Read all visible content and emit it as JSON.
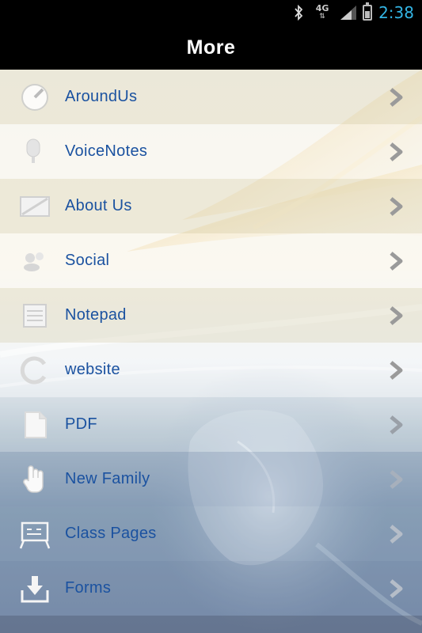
{
  "status_bar": {
    "network": "4G",
    "time": "2:38"
  },
  "header": {
    "title": "More"
  },
  "menu": {
    "items": [
      {
        "label": "AroundUs",
        "icon": "compass-icon"
      },
      {
        "label": "VoiceNotes",
        "icon": "microphone-icon"
      },
      {
        "label": "About Us",
        "icon": "info-icon"
      },
      {
        "label": "Social",
        "icon": "people-icon"
      },
      {
        "label": "Notepad",
        "icon": "notepad-icon"
      },
      {
        "label": "website",
        "icon": "globe-icon"
      },
      {
        "label": "PDF",
        "icon": "document-icon"
      },
      {
        "label": "New Family",
        "icon": "hand-icon"
      },
      {
        "label": "Class Pages",
        "icon": "chalkboard-icon"
      },
      {
        "label": "Forms",
        "icon": "download-tray-icon"
      }
    ]
  },
  "colors": {
    "label": "#1b52a0",
    "clock": "#33b5e5",
    "title_bar": "#000000"
  }
}
